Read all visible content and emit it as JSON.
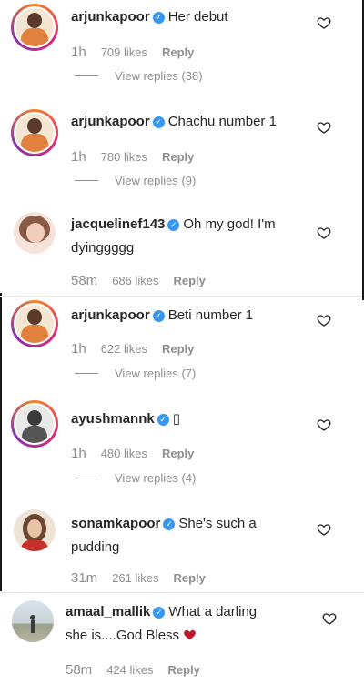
{
  "colors": {
    "link": "#3897f0",
    "muted": "#8e8e8e",
    "heart": "#c0182b"
  },
  "comments": [
    {
      "username": "arjunkapoor",
      "text": "Her debut",
      "time": "1h",
      "likes": "709 likes",
      "reply_label": "Reply",
      "view_replies": "View replies (38)"
    },
    {
      "username": "arjunkapoor",
      "text": "Chachu number 1",
      "time": "1h",
      "likes": "780 likes",
      "reply_label": "Reply",
      "view_replies": "View replies (9)"
    },
    {
      "username": "jacquelinef143",
      "text": "Oh my god! I'm",
      "text2": "dyinggggg",
      "time": "58m",
      "likes": "686 likes",
      "reply_label": "Reply"
    },
    {
      "username": "arjunkapoor",
      "text": "Beti number 1",
      "time": "1h",
      "likes": "622 likes",
      "reply_label": "Reply",
      "view_replies": "View replies (7)"
    },
    {
      "username": "ayushmannk",
      "text": "▯",
      "time": "1h",
      "likes": "480 likes",
      "reply_label": "Reply",
      "view_replies": "View replies (4)"
    },
    {
      "username": "sonamkapoor",
      "text": "She's such a",
      "text2": "pudding",
      "time": "31m",
      "likes": "261 likes",
      "reply_label": "Reply"
    },
    {
      "username": "amaal_mallik",
      "text": "What a darling",
      "text2": "she is....God Bless",
      "time": "58m",
      "likes": "424 likes",
      "reply_label": "Reply"
    }
  ]
}
